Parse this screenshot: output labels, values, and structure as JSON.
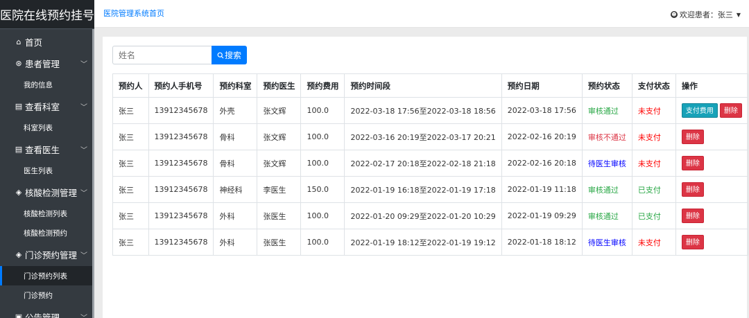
{
  "brand": "医院在线预约挂号",
  "breadcrumb": "医院管理系统首页",
  "user": {
    "welcome": "欢迎患者：张三"
  },
  "sidebar": {
    "home": {
      "icon": "home-icon",
      "label": "首页"
    },
    "groups": [
      {
        "label": "患者管理",
        "icon": "user-circle-icon",
        "items": [
          "我的信息"
        ]
      },
      {
        "label": "查看科室",
        "icon": "document-icon",
        "items": [
          "科室列表"
        ]
      },
      {
        "label": "查看医生",
        "icon": "document-icon",
        "items": [
          "医生列表"
        ]
      },
      {
        "label": "核酸检测管理",
        "icon": "layers-icon",
        "items": [
          "核酸检测列表",
          "核酸检测预约"
        ]
      },
      {
        "label": "门诊预约管理",
        "icon": "layers-icon",
        "items": [
          "门诊预约列表",
          "门诊预约"
        ]
      },
      {
        "label": "公告管理",
        "icon": "announcement-icon",
        "items": []
      }
    ],
    "active_item": "门诊预约列表"
  },
  "search": {
    "placeholder": "姓名",
    "button": "搜索"
  },
  "table": {
    "headers": [
      "预约人",
      "预约人手机号",
      "预约科室",
      "预约医生",
      "预约费用",
      "预约时间段",
      "预约日期",
      "预约状态",
      "支付状态",
      "操作"
    ],
    "rows": [
      {
        "name": "张三",
        "phone": "13912345678",
        "dept": "外壳",
        "doctor": "张文辉",
        "fee": "100.0",
        "period": "2022-03-18 17:56至2022-03-18 18:56",
        "date": "2022-03-18 17:56",
        "status": "审核通过",
        "pay": "未支付",
        "show_pay_btn": true
      },
      {
        "name": "张三",
        "phone": "13912345678",
        "dept": "骨科",
        "doctor": "张文辉",
        "fee": "100.0",
        "period": "2022-03-16 20:19至2022-03-17 20:21",
        "date": "2022-02-16 20:19",
        "status": "审核不通过",
        "pay": "未支付",
        "show_pay_btn": false
      },
      {
        "name": "张三",
        "phone": "13912345678",
        "dept": "骨科",
        "doctor": "张文辉",
        "fee": "100.0",
        "period": "2022-02-17 20:18至2022-02-18 21:18",
        "date": "2022-02-16 20:18",
        "status": "待医生审核",
        "pay": "未支付",
        "show_pay_btn": false
      },
      {
        "name": "张三",
        "phone": "13912345678",
        "dept": "神经科",
        "doctor": "李医生",
        "fee": "150.0",
        "period": "2022-01-19 16:18至2022-01-19 17:18",
        "date": "2022-01-19 11:18",
        "status": "审核通过",
        "pay": "已支付",
        "show_pay_btn": false
      },
      {
        "name": "张三",
        "phone": "13912345678",
        "dept": "外科",
        "doctor": "张医生",
        "fee": "100.0",
        "period": "2022-01-20 09:29至2022-01-20 10:29",
        "date": "2022-01-19 09:29",
        "status": "审核通过",
        "pay": "已支付",
        "show_pay_btn": false
      },
      {
        "name": "张三",
        "phone": "13912345678",
        "dept": "外科",
        "doctor": "张医生",
        "fee": "100.0",
        "period": "2022-01-19 18:12至2022-01-19 19:12",
        "date": "2022-01-18 18:12",
        "status": "待医生审核",
        "pay": "未支付",
        "show_pay_btn": false
      }
    ],
    "actions": {
      "pay": "支付费用",
      "delete": "删除"
    }
  },
  "colors": {
    "primary": "#007bff",
    "sidebar": "#343a40",
    "brand_bg": "#212529",
    "pass": "#28a745",
    "fail": "#dc3545",
    "wait": "#0000ff",
    "pay_btn": "#17a2b8"
  }
}
